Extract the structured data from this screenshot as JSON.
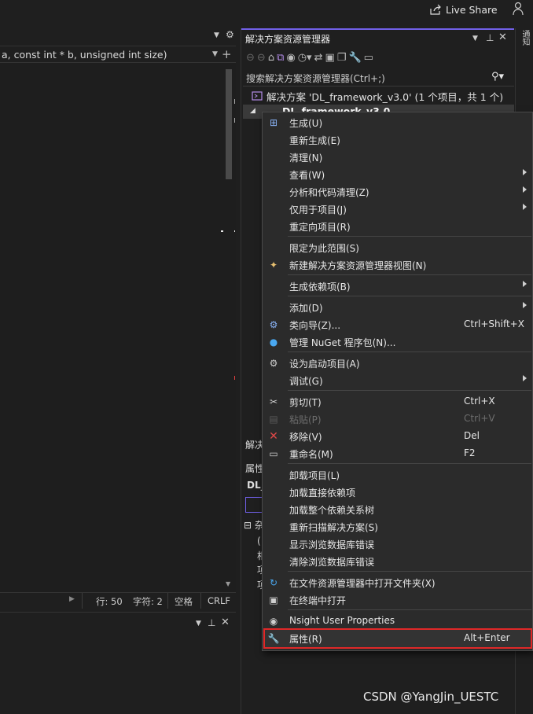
{
  "topbar": {
    "live_share": "Live Share"
  },
  "editor": {
    "signature": "a, const int * b, unsigned int size)",
    "status": {
      "line": "行: 50",
      "char": "字符: 2",
      "spacing": "空格",
      "eol": "CRLF"
    }
  },
  "solution_explorer": {
    "title": "解决方案资源管理器",
    "search_placeholder": "搜索解决方案资源管理器(Ctrl+;)",
    "solution_label": "解决方案 'DL_framework_v3.0' (1 个项目，共 1 个)",
    "project_label": "DL_framework_v3.0",
    "bottom_tab": "解决",
    "properties": {
      "title": "属性",
      "item": "DL_",
      "row1": "⊟ 杂",
      "row2": "(",
      "row3": "相",
      "row4": "项",
      "row5": "项"
    }
  },
  "context_menu": {
    "items": [
      {
        "label": "生成(U)",
        "shortcut": "",
        "icon": "build-icon"
      },
      {
        "label": "重新生成(E)",
        "shortcut": ""
      },
      {
        "label": "清理(N)",
        "shortcut": ""
      },
      {
        "label": "查看(W)",
        "shortcut": "",
        "submenu": true
      },
      {
        "label": "分析和代码清理(Z)",
        "shortcut": "",
        "submenu": true
      },
      {
        "label": "仅用于项目(J)",
        "shortcut": "",
        "submenu": true
      },
      {
        "label": "重定向项目(R)",
        "shortcut": ""
      },
      {
        "label": "限定为此范围(S)",
        "shortcut": ""
      },
      {
        "label": "新建解决方案资源管理器视图(N)",
        "shortcut": "",
        "icon": "new-view-icon"
      },
      {
        "label": "生成依赖项(B)",
        "shortcut": "",
        "submenu": true
      },
      {
        "label": "添加(D)",
        "shortcut": "",
        "submenu": true
      },
      {
        "label": "类向导(Z)...",
        "shortcut": "Ctrl+Shift+X",
        "icon": "class-wizard-icon"
      },
      {
        "label": "管理 NuGet 程序包(N)...",
        "shortcut": "",
        "icon": "nuget-icon"
      },
      {
        "label": "设为启动项目(A)",
        "shortcut": "",
        "icon": "gear-icon"
      },
      {
        "label": "调试(G)",
        "shortcut": "",
        "submenu": true
      },
      {
        "label": "剪切(T)",
        "shortcut": "Ctrl+X",
        "icon": "scissors-icon"
      },
      {
        "label": "粘贴(P)",
        "shortcut": "Ctrl+V",
        "icon": "paste-icon",
        "disabled": true
      },
      {
        "label": "移除(V)",
        "shortcut": "Del",
        "icon": "remove-icon"
      },
      {
        "label": "重命名(M)",
        "shortcut": "F2",
        "icon": "rename-icon"
      },
      {
        "label": "卸载项目(L)",
        "shortcut": ""
      },
      {
        "label": "加载直接依赖项",
        "shortcut": ""
      },
      {
        "label": "加载整个依赖关系树",
        "shortcut": ""
      },
      {
        "label": "重新扫描解决方案(S)",
        "shortcut": ""
      },
      {
        "label": "显示浏览数据库错误",
        "shortcut": ""
      },
      {
        "label": "清除浏览数据库错误",
        "shortcut": ""
      },
      {
        "label": "在文件资源管理器中打开文件夹(X)",
        "shortcut": "",
        "icon": "open-folder-icon"
      },
      {
        "label": "在终端中打开",
        "shortcut": "",
        "icon": "terminal-icon"
      },
      {
        "label": "Nsight User Properties",
        "shortcut": "",
        "icon": "nsight-icon"
      },
      {
        "label": "属性(R)",
        "shortcut": "Alt+Enter",
        "icon": "wrench-icon"
      }
    ]
  },
  "colors": {
    "accent": "#7160e8",
    "highlight_border": "#e02828",
    "menu_bg": "#2b2b2b"
  },
  "watermark": "CSDN @YangJin_UESTC"
}
